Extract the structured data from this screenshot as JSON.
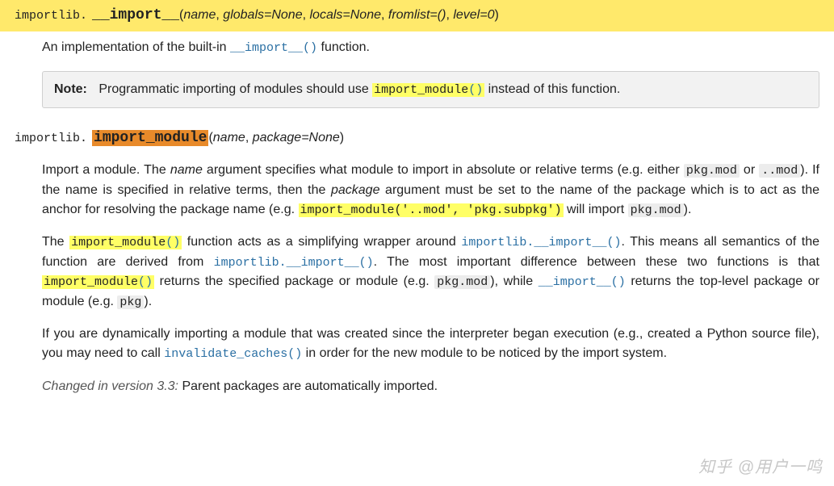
{
  "fn1": {
    "module": "importlib.",
    "name": "__import__",
    "p1": "name",
    "p2": "globals=None",
    "p3": "locals=None",
    "p4": "fromlist=()",
    "p5": "level=0",
    "desc_a": "An implementation of the built-in ",
    "desc_link": "__import__()",
    "desc_b": " function.",
    "note_label": "Note:",
    "note_a": "Programmatic importing of modules should use ",
    "note_xref": "import_module",
    "note_paren": "()",
    "note_b": " instead of this function."
  },
  "fn2": {
    "module": "importlib.",
    "name": "import_module",
    "p1": "name",
    "p2": "package=None",
    "para1": {
      "a": "Import a module. The ",
      "name_em": "name",
      "b": " argument specifies what module to import in absolute or relative terms (e.g. either ",
      "pkgmod": "pkg.mod",
      "c": " or ",
      "dotmod": "..mod",
      "d": "). If the name is specified in relative terms, then the ",
      "package_em": "package",
      "e": " argument must be set to the name of the package which is to act as the anchor for resolving the package name (e.g. ",
      "call": "import_module('..mod', 'pkg.subpkg')",
      "f": " will import ",
      "pkgmod2": "pkg.mod",
      "g": ")."
    },
    "para2": {
      "a": "The ",
      "im": "import_module",
      "paren": "()",
      "b": " function acts as a simplifying wrapper around ",
      "impimp": "importlib.__import__()",
      "c": ". This means all semantics of the function are derived from ",
      "impimp2": "importlib.__import__()",
      "d": ". The most important difference between these two functions is that ",
      "im2": "import_module",
      "paren2": "()",
      "e": " returns the specified package or module (e.g. ",
      "pkgmod": "pkg.mod",
      "f": "), while ",
      "dimport": "__import__()",
      "g": " returns the top-level package or module (e.g. ",
      "pkg": "pkg",
      "h": ")."
    },
    "para3": {
      "a": "If you are dynamically importing a module that was created since the interpreter began execution (e.g., created a Python source file), you may need to call ",
      "inv": "invalidate_caches()",
      "b": " in order for the new module to be noticed by the import system."
    },
    "changed_label": "Changed in version 3.3:",
    "changed_text": " Parent packages are automatically imported."
  },
  "watermark": "知乎 @用户一鸣"
}
